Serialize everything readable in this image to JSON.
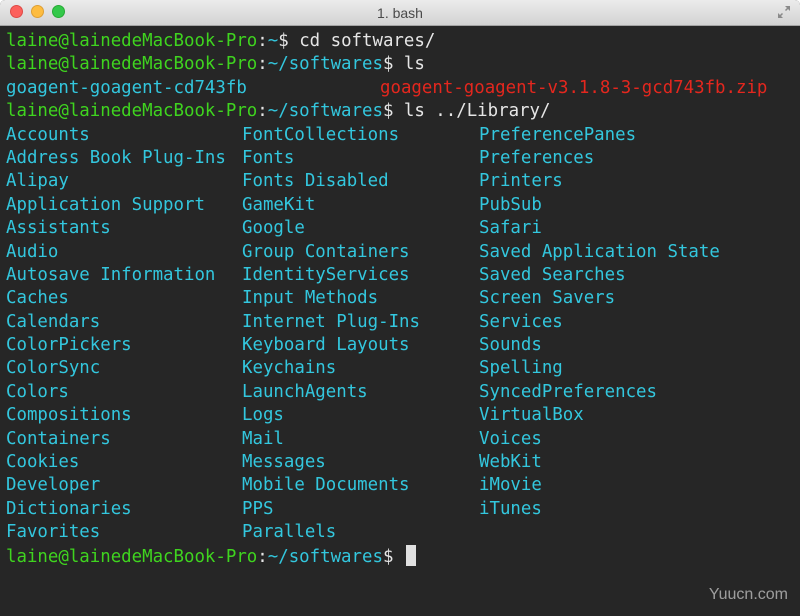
{
  "window": {
    "title": "1. bash",
    "icons": {
      "close": "close-icon",
      "minimize": "minimize-icon",
      "zoom": "zoom-icon",
      "fullscreen": "fullscreen-icon"
    }
  },
  "prompt": {
    "user_host": "laine@lainedeMacBook-Pro",
    "separator": ":",
    "home_path": "~",
    "softwares_path": "~/softwares",
    "symbol": "$"
  },
  "commands": {
    "cmd1": " cd softwares/",
    "cmd2": " ls",
    "cmd3": " ls ../Library/",
    "cmd4": " "
  },
  "ls_softwares": {
    "folder": "goagent-goagent-cd743fb",
    "zip": "goagent-goagent-v3.1.8-3-gcd743fb.zip"
  },
  "library_rows": [
    [
      "Accounts",
      "FontCollections",
      "PreferencePanes"
    ],
    [
      "Address Book Plug-Ins",
      "Fonts",
      "Preferences"
    ],
    [
      "Alipay",
      "Fonts Disabled",
      "Printers"
    ],
    [
      "Application Support",
      "GameKit",
      "PubSub"
    ],
    [
      "Assistants",
      "Google",
      "Safari"
    ],
    [
      "Audio",
      "Group Containers",
      "Saved Application State"
    ],
    [
      "Autosave Information",
      "IdentityServices",
      "Saved Searches"
    ],
    [
      "Caches",
      "Input Methods",
      "Screen Savers"
    ],
    [
      "Calendars",
      "Internet Plug-Ins",
      "Services"
    ],
    [
      "ColorPickers",
      "Keyboard Layouts",
      "Sounds"
    ],
    [
      "ColorSync",
      "Keychains",
      "Spelling"
    ],
    [
      "Colors",
      "LaunchAgents",
      "SyncedPreferences"
    ],
    [
      "Compositions",
      "Logs",
      "VirtualBox"
    ],
    [
      "Containers",
      "Mail",
      "Voices"
    ],
    [
      "Cookies",
      "Messages",
      "WebKit"
    ],
    [
      "Developer",
      "Mobile Documents",
      "iMovie"
    ],
    [
      "Dictionaries",
      "PPS",
      "iTunes"
    ],
    [
      "Favorites",
      "Parallels",
      ""
    ]
  ],
  "watermark": "Yuucn.com",
  "colors": {
    "background": "#262626",
    "prompt_user": "#3fd41f",
    "directory": "#33c7de",
    "archive": "#e4271e",
    "text": "#e6e6e6"
  }
}
